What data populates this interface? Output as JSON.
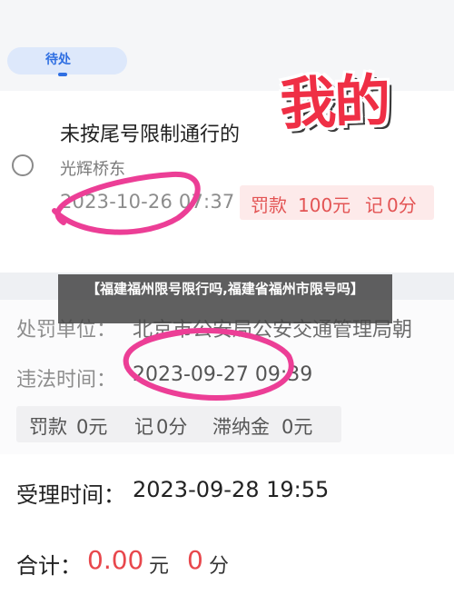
{
  "header": {
    "tab_label": "待处"
  },
  "stamp": {
    "text": "我的"
  },
  "record1": {
    "title": "未按尾号限制通行的",
    "location": "光辉桥东",
    "time": "2023-10-26 07:37",
    "fine_label": "罚款",
    "fine_amount": "100元",
    "points_label": "记",
    "points": "0分"
  },
  "overlay": {
    "text": "【福建福州限号限行吗,福建省福州市限号吗】"
  },
  "detail": {
    "dept_label": "处罚单位：",
    "dept_value": "北京市公安局公安交通管理局朝",
    "time_label": "违法时间：",
    "time_value": "2023-09-27 09:39",
    "fine_label": "罚款",
    "fine_value": "0元",
    "points_label": "记",
    "points_value": "0分",
    "late_label": "滞纳金",
    "late_value": "0元"
  },
  "footer": {
    "accept_label": "受理时间：",
    "accept_value": "2023-09-28 19:55",
    "total_label": "合计：",
    "total_amount": "0.00",
    "total_unit": "元",
    "total_points": "0",
    "total_points_unit": "分"
  },
  "colors": {
    "accent_red": "#e8474c",
    "annotation_pink": "#ec3e96",
    "tab_blue": "#2f6fe2"
  }
}
